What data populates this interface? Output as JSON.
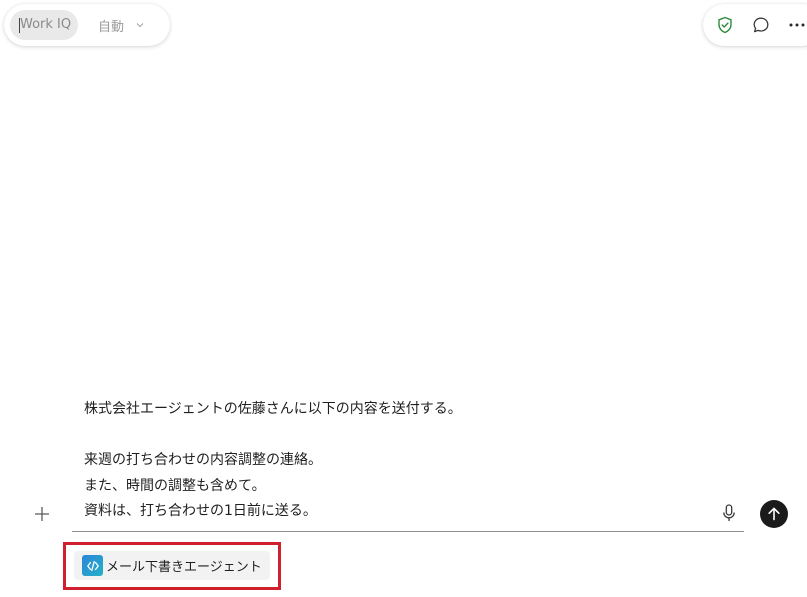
{
  "header": {
    "mode_chip": "Work IQ",
    "model_select": "自動"
  },
  "toolbar_right": {
    "icons": [
      "shield-check-icon",
      "chat-bubble-icon",
      "more-icon"
    ],
    "accent_color": "#2e8b3e"
  },
  "composer": {
    "lines": [
      "株式会社エージェントの佐藤さんに以下の内容を送付する。",
      "",
      "来週の打ち合わせの内容調整の連絡。",
      "また、時間の調整も含めて。",
      "資料は、打ち合わせの1日前に送る。"
    ]
  },
  "agent_suggestion": {
    "label": "メール下書きエージェント",
    "highlight_color": "#d0202e"
  }
}
